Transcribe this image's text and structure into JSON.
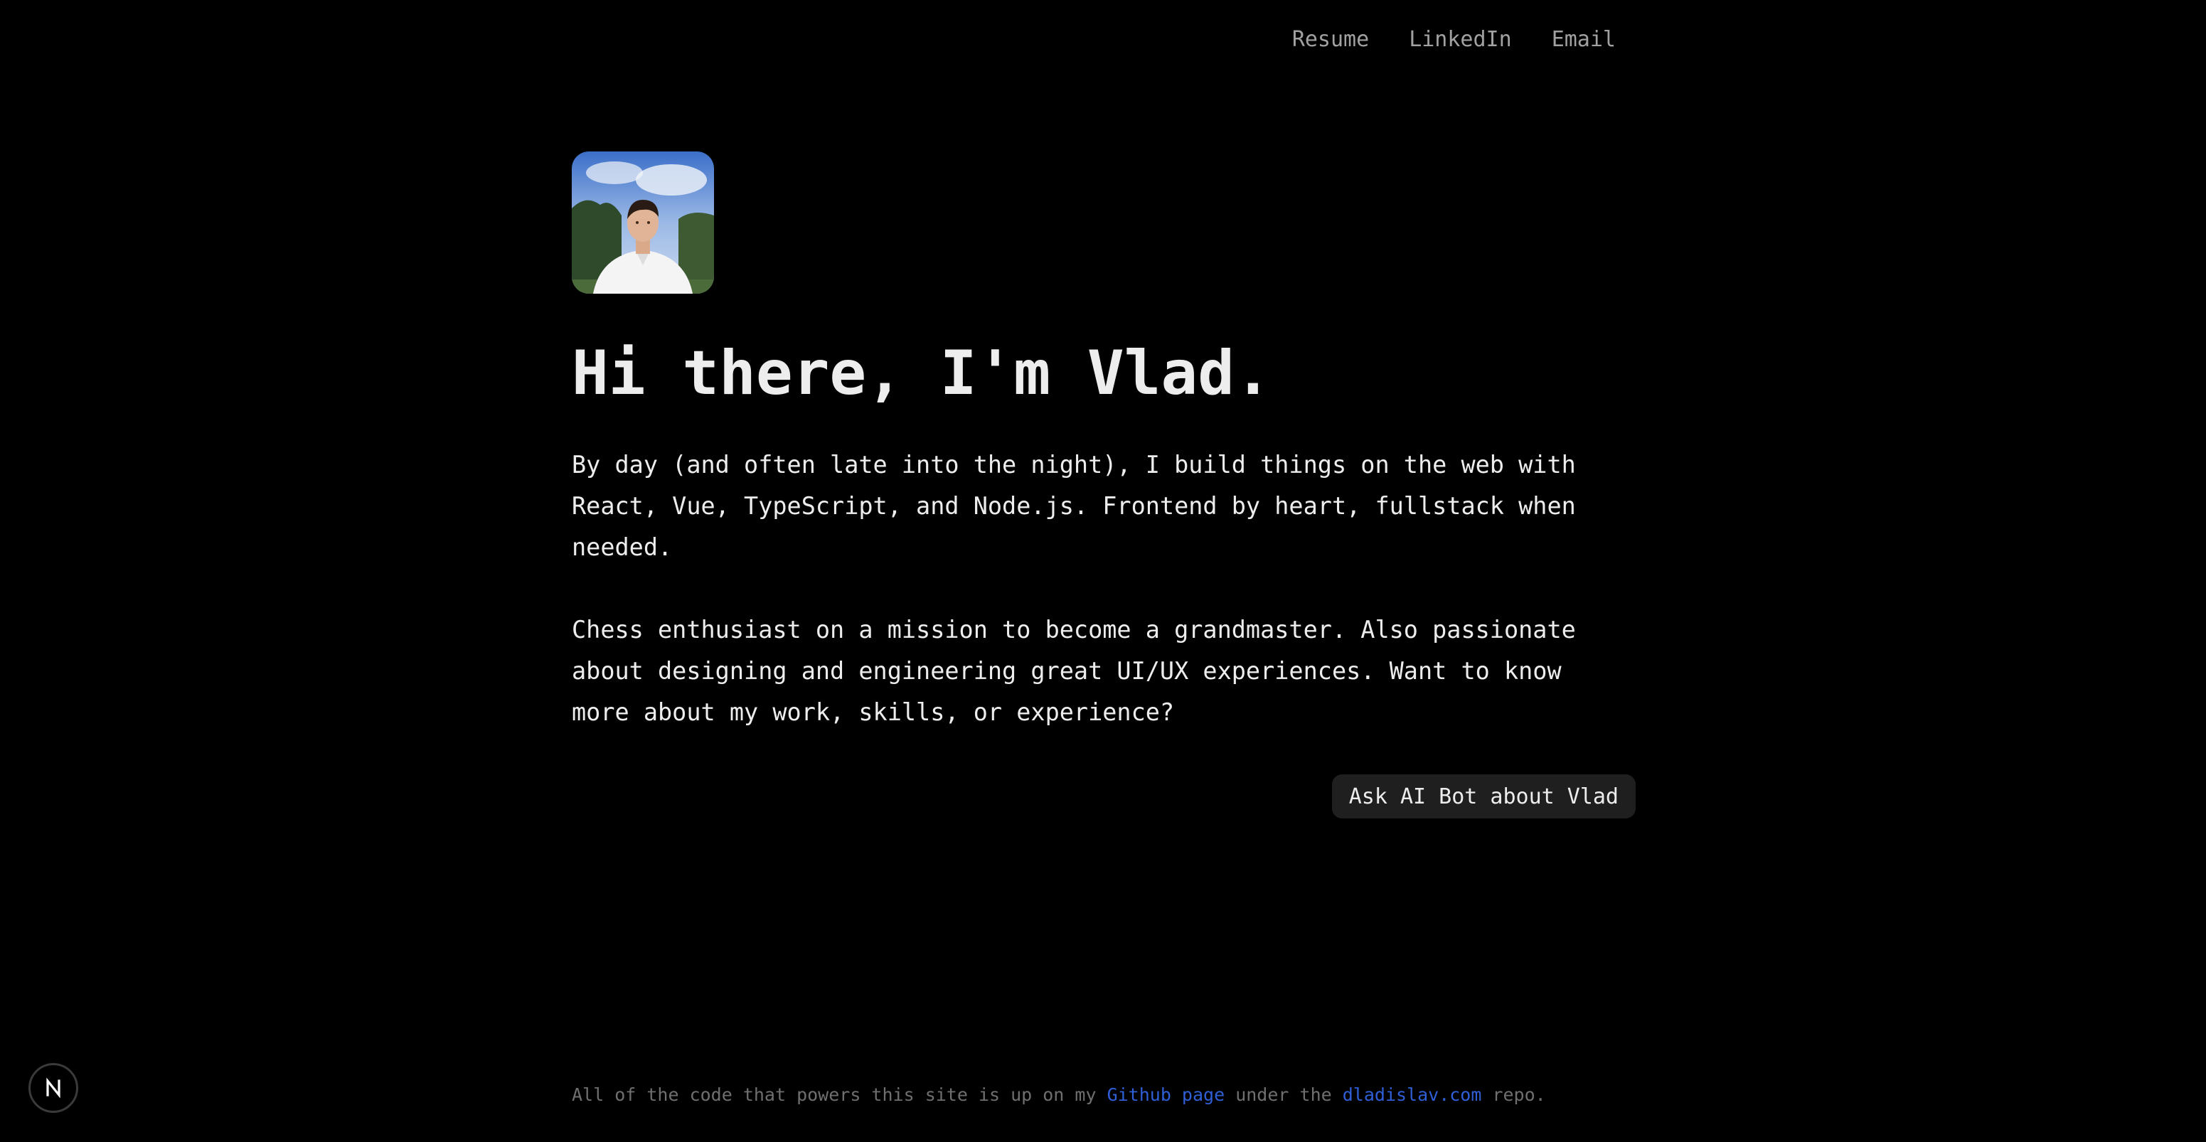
{
  "nav": {
    "links": [
      {
        "label": "Resume"
      },
      {
        "label": "LinkedIn"
      },
      {
        "label": "Email"
      }
    ]
  },
  "profile": {
    "avatar_icon": "profile-photo"
  },
  "hero": {
    "title": "Hi there, I'm Vlad.",
    "paragraphs": [
      "By day (and often late into the night), I build things on the web with React, Vue, TypeScript, and Node.js. Frontend by heart, fullstack when needed.",
      "Chess enthusiast on a mission to become a grandmaster. Also passionate about designing and engineering great UI/UX experiences. Want to know more about my work, skills, or experience?"
    ],
    "ask_button": "Ask AI Bot about Vlad"
  },
  "footer": {
    "text_before": "All of the code that powers this site is up on my ",
    "github_link": "Github page",
    "text_middle": " under the ",
    "repo_link": "dladislav.com",
    "text_after": " repo."
  },
  "devtools": {
    "icon": "nextjs-logo-icon"
  },
  "colors": {
    "background": "#000000",
    "text": "#ededed",
    "muted": "#a1a1a1",
    "link": "#2f5fd6",
    "button_bg": "#1f1f1f"
  }
}
